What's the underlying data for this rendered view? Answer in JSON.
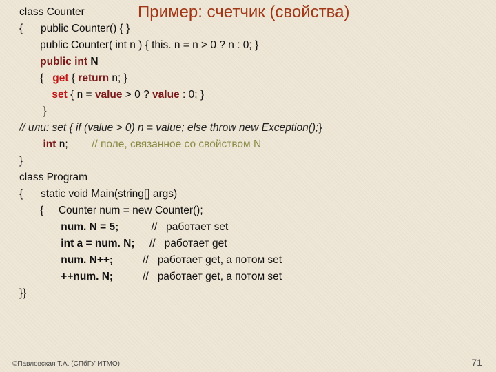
{
  "title": "Пример: счетчик (свойства)",
  "lines": {
    "l1a": "class Counter",
    "l2": "{      public Counter() { }",
    "l3a": "       public Counter( int n ) { this. n = n > 0 ? n : 0; }",
    "l4kw": "public int",
    "l4n": " N",
    "l5a": "       {   ",
    "l5get": "get",
    "l5b": " { ",
    "l5ret": "return",
    "l5c": " n; }",
    "l6a": "           ",
    "l6set": "set",
    "l6b": " { n = ",
    "l6val1": "value",
    "l6c": " > 0 ? ",
    "l6val2": "value",
    "l6d": " : 0; }",
    "l7": "        }",
    "l8a": "// или: set { if (value > 0) n = value; else throw new Exception();",
    "l8b": "}",
    "l9a": "        ",
    "l9kw": "int",
    "l9b": " n;",
    "l9c": "        // поле, связанное со свойством N",
    "l10": "}",
    "l11": "class Program",
    "l12": "{      static void Main(string[] args)",
    "l13": "       {     Counter num = new Counter();",
    "l14a": "              ",
    "l14b": "num. N = 5;",
    "l14c": "           //   работает set",
    "l15a": "              ",
    "l15b": "int a = num. N;",
    "l15c": "     //   работает get",
    "l16a": "              ",
    "l16b": "num. N++;",
    "l16c": "          //   работает get, а потом set",
    "l17a": "              ",
    "l17b": "++num. N;",
    "l17c": "          //   работает get, а потом set",
    "l18": "}}"
  },
  "footerLeft": "©Павловская Т.А. (СПбГУ ИТМО)",
  "footerRight": "71"
}
